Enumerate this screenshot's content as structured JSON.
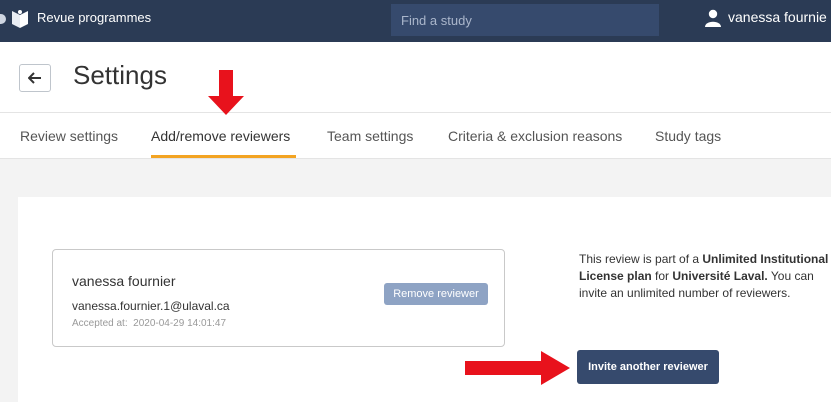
{
  "topbar": {
    "app_name": "Revue programmes",
    "search_placeholder": "Find a study",
    "user_name": "vanessa fournie"
  },
  "header": {
    "title": "Settings"
  },
  "tabs": [
    {
      "label": "Review settings",
      "active": false
    },
    {
      "label": "Add/remove reviewers",
      "active": true
    },
    {
      "label": "Team settings",
      "active": false
    },
    {
      "label": "Criteria & exclusion reasons",
      "active": false
    },
    {
      "label": "Study tags",
      "active": false
    }
  ],
  "reviewer": {
    "name": "vanessa fournier",
    "email": "vanessa.fournier.1@ulaval.ca",
    "accepted_label": "Accepted at:",
    "accepted_at": "2020-04-29 14:01:47",
    "remove_label": "Remove reviewer"
  },
  "license_info": {
    "prefix": "This review is part of a ",
    "plan": "Unlimited Institutional License plan",
    "middle": " for ",
    "institution": "Université Laval.",
    "suffix": " You can invite an unlimited number of reviewers."
  },
  "invite_label": "Invite another reviewer",
  "colors": {
    "topbar": "#2b3b55",
    "active_tab_underline": "#f3a422",
    "primary_button": "#364a6d",
    "disabled_button": "#8ea3c4",
    "annotation_arrow": "#e8121c"
  }
}
